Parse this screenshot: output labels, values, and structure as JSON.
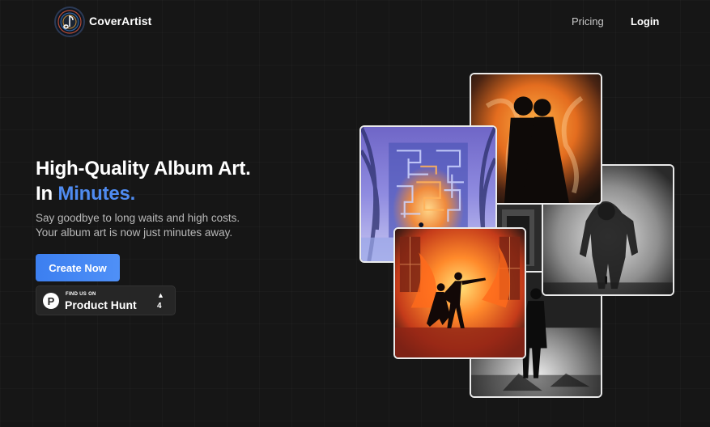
{
  "header": {
    "brand": "CoverArtist",
    "nav": {
      "pricing": "Pricing",
      "login": "Login"
    }
  },
  "hero": {
    "headline_line1": "High-Quality Album Art.",
    "headline_prefix": "In ",
    "headline_accent": "Minutes.",
    "subtitle_line1": "Say goodbye to long waits and high costs.",
    "subtitle_line2": "Your album art is now just minutes away.",
    "cta_label": "Create Now"
  },
  "product_hunt": {
    "eyebrow": "FIND US ON",
    "name": "Product Hunt",
    "upvotes": "4"
  },
  "colors": {
    "accent": "#4f8bf0",
    "background": "#161616"
  }
}
